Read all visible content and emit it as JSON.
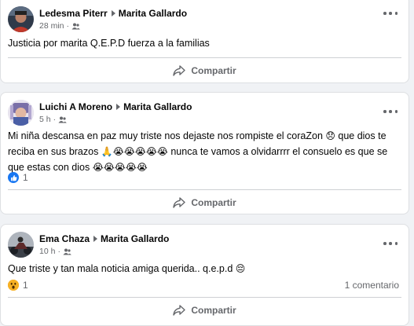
{
  "posts": [
    {
      "author": "Ledesma Piterr",
      "target": "Marita Gallardo",
      "time": "28 min",
      "text": "Justicia por marita Q.E.P.D fuerza a la familias",
      "share_label": "Compartir"
    },
    {
      "author": "Luichi A Moreno",
      "target": "Marita Gallardo",
      "time": "5 h",
      "text_parts": [
        "Mi niña descansa en paz muy triste nos dejaste nos rompiste el coraZon ",
        "😞",
        " que dios te reciba en sus brazos ",
        "🙏😭😭😭😭😭",
        " nunca te vamos a olvidarrrr el consuelo es que se que estas con dios ",
        "😭😭😭😭😭"
      ],
      "reaction_count": "1",
      "reaction_type": "like-icon",
      "share_label": "Compartir"
    },
    {
      "author": "Ema Chaza",
      "target": "Marita Gallardo",
      "time": "10 h",
      "text_parts": [
        "Que triste y tan mala noticia amiga querida.. q.e.p.d ",
        "😔"
      ],
      "reaction_count": "1",
      "reaction_type": "wow-icon",
      "comments": "1 comentario",
      "share_label": "Compartir"
    }
  ],
  "colors": {
    "background": "#f0f2f5",
    "card": "#ffffff",
    "secondary_text": "#65676b",
    "like_blue": "#1877f2",
    "wow_yellow": "#f7b125"
  }
}
